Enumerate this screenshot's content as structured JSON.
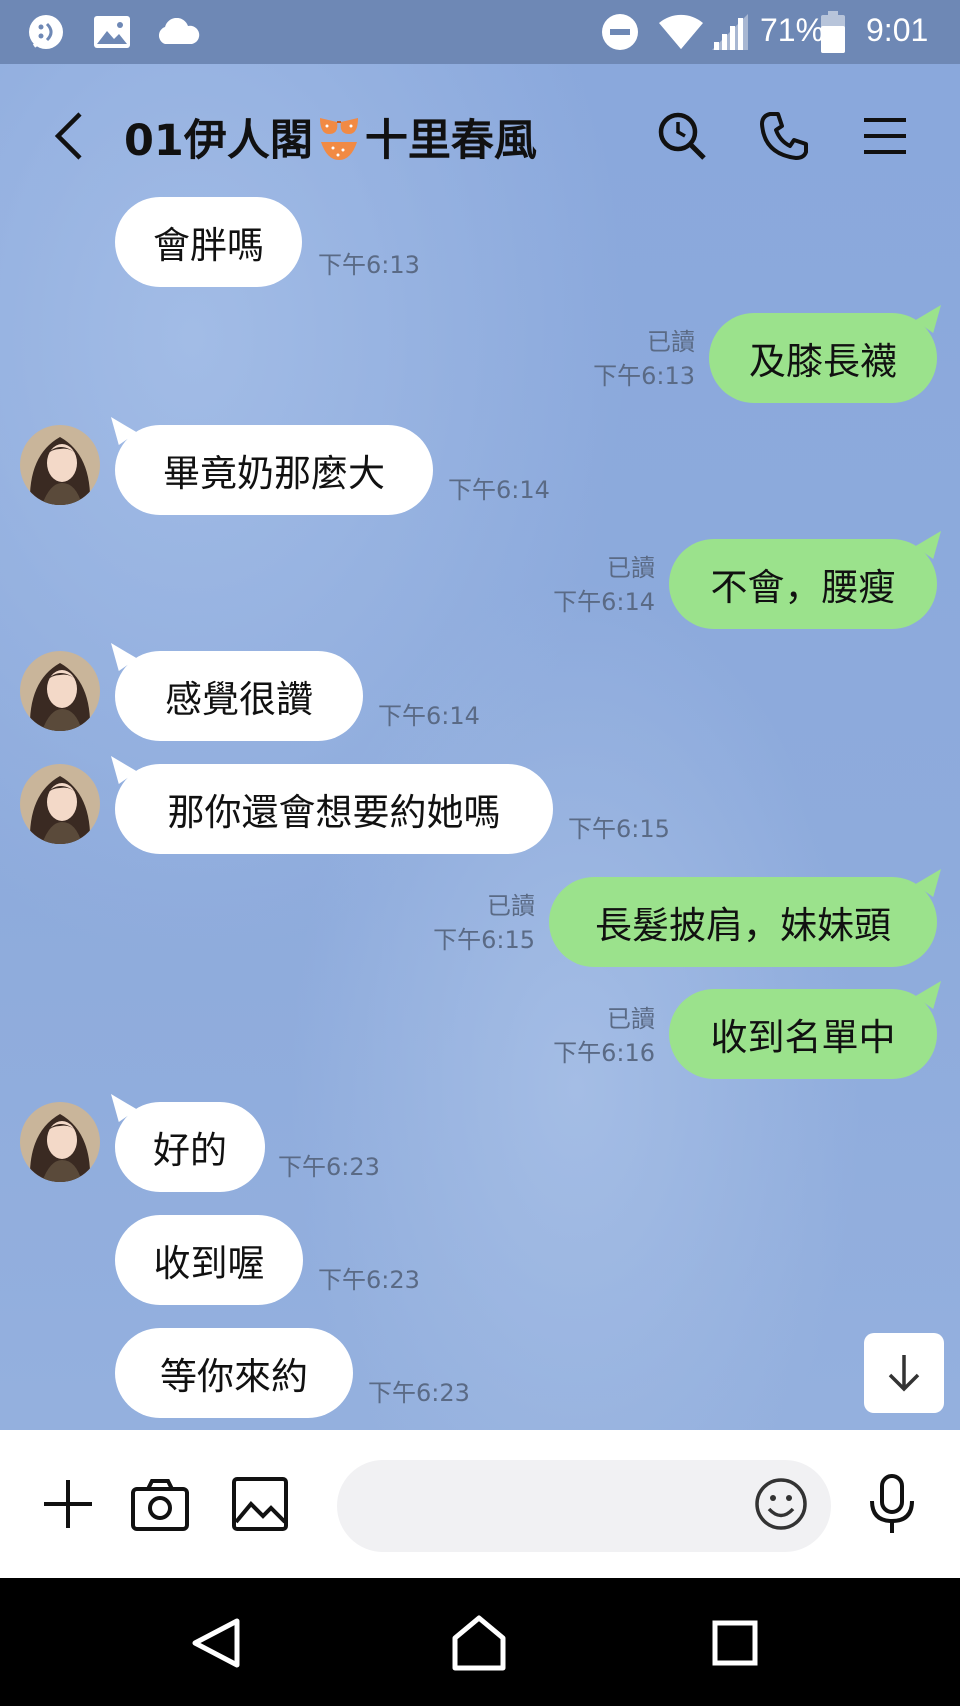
{
  "status_bar": {
    "battery_percent": "71%",
    "time": "9:01",
    "icons": [
      "messenger-icon",
      "gallery-icon",
      "cloud-icon",
      "dnd-icon",
      "wifi-icon",
      "signal-icon",
      "battery-icon"
    ]
  },
  "header": {
    "title_prefix": "01伊人閣",
    "title_suffix": "十里春風",
    "emoji": "bikini-emoji",
    "buttons": [
      "back-icon",
      "search-icon",
      "phone-icon",
      "menu-icon"
    ]
  },
  "messages": [
    {
      "side": "in",
      "avatar": false,
      "text": "會胖嗎",
      "time": "下午6:13"
    },
    {
      "side": "out",
      "text": "及膝長襪",
      "read": "已讀",
      "time": "下午6:13"
    },
    {
      "side": "in",
      "avatar": true,
      "text": "畢竟奶那麼大",
      "time": "下午6:14"
    },
    {
      "side": "out",
      "text": "不會，腰瘦",
      "read": "已讀",
      "time": "下午6:14"
    },
    {
      "side": "in",
      "avatar": true,
      "text": "感覺很讚",
      "time": "下午6:14"
    },
    {
      "side": "in",
      "avatar": true,
      "text": "那你還會想要約她嗎",
      "time": "下午6:15"
    },
    {
      "side": "out",
      "text": "長髮披肩，妹妹頭",
      "read": "已讀",
      "time": "下午6:15"
    },
    {
      "side": "out",
      "text": "收到名單中",
      "read": "已讀",
      "time": "下午6:16"
    },
    {
      "side": "in",
      "avatar": true,
      "text": "好的",
      "time": "下午6:23"
    },
    {
      "side": "in",
      "avatar": false,
      "text": "收到喔",
      "time": "下午6:23"
    },
    {
      "side": "in",
      "avatar": false,
      "text": "等你來約",
      "time": "下午6:23"
    }
  ],
  "input_bar": {
    "placeholder": "",
    "buttons": [
      "plus-icon",
      "camera-icon",
      "image-icon",
      "emoji-icon",
      "mic-icon"
    ]
  },
  "nav_bar": {
    "buttons": [
      "back-triangle-icon",
      "home-icon",
      "recents-icon"
    ]
  },
  "colors": {
    "chat_bg": "#8eabdc",
    "outgoing_bubble": "#9be28c",
    "incoming_bubble": "#ffffff",
    "status_bar": "#6e88b5"
  }
}
